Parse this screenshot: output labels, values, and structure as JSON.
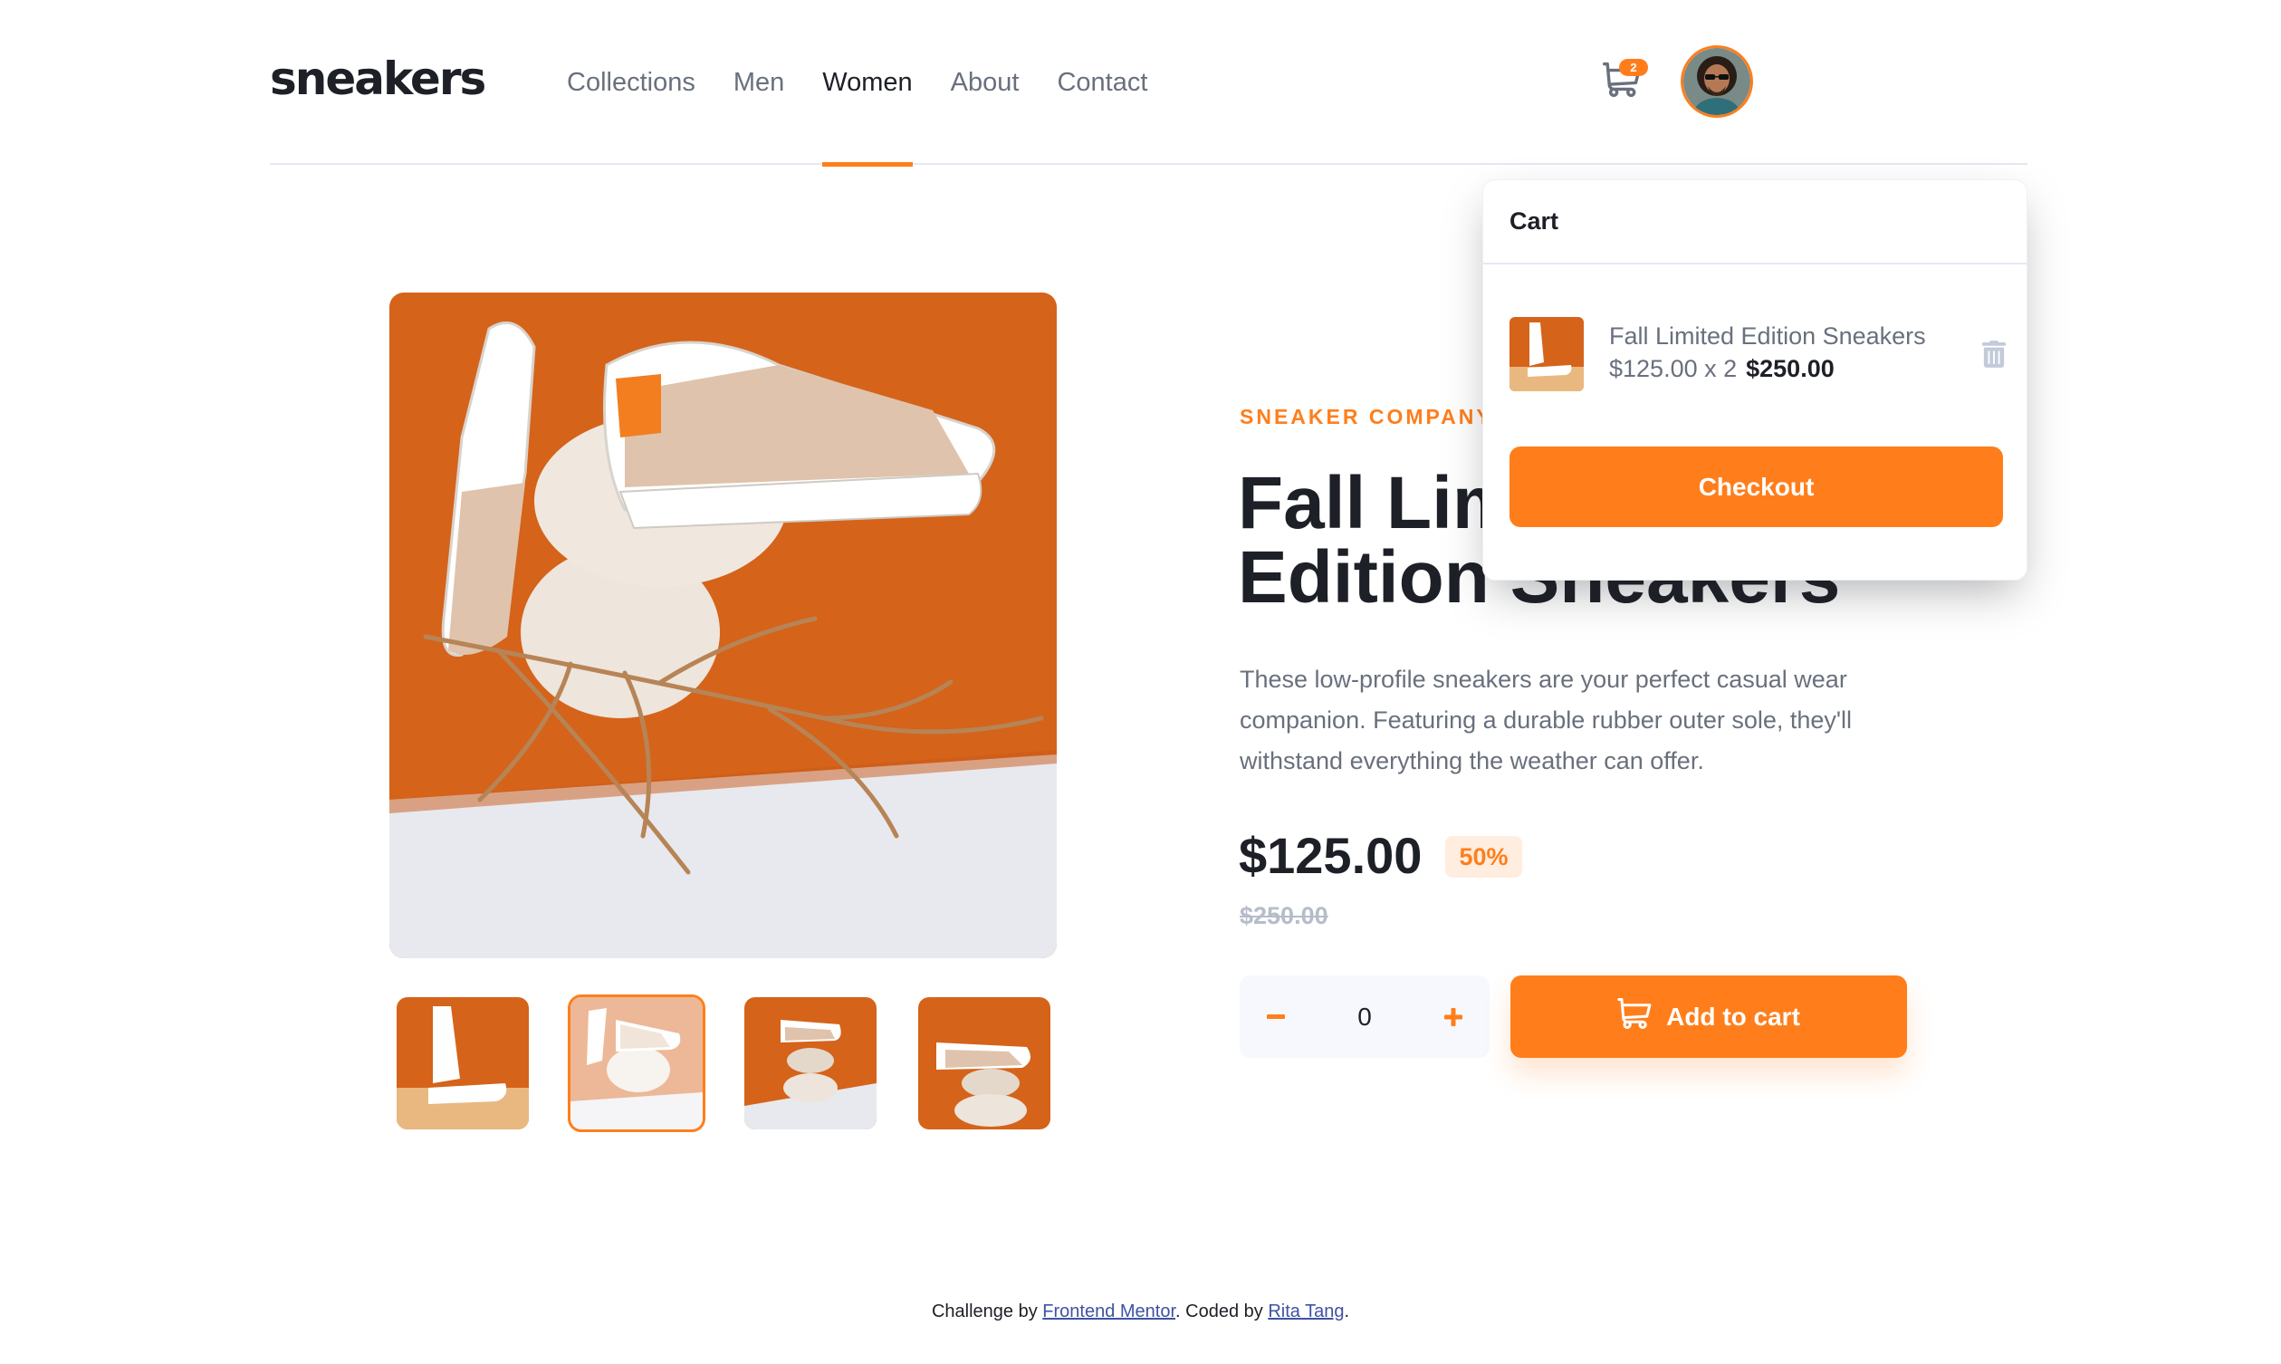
{
  "brand": {
    "logo": "sneakers"
  },
  "nav": {
    "items": [
      {
        "label": "Collections",
        "active": false
      },
      {
        "label": "Men",
        "active": false
      },
      {
        "label": "Women",
        "active": true
      },
      {
        "label": "About",
        "active": false
      },
      {
        "label": "Contact",
        "active": false
      }
    ]
  },
  "header": {
    "cart_count": "2",
    "cart_icon": "cart-icon",
    "avatar_icon": "user-avatar"
  },
  "gallery": {
    "main_image": "sneaker-on-stones-photo",
    "thumbnails": [
      {
        "name": "thumbnail-1",
        "active": false
      },
      {
        "name": "thumbnail-2",
        "active": true
      },
      {
        "name": "thumbnail-3",
        "active": false
      },
      {
        "name": "thumbnail-4",
        "active": false
      }
    ]
  },
  "product": {
    "company": "SNEAKER COMPANY",
    "title": "Fall Limited Edition Sneakers",
    "description": "These low-profile sneakers are your perfect casual wear companion. Featuring a durable rubber outer sole, they'll withstand everything the weather can offer.",
    "price": "$125.00",
    "discount": "50%",
    "original_price": "$250.00",
    "quantity": "0",
    "add_to_cart_label": "Add to cart"
  },
  "cart": {
    "title": "Cart",
    "item": {
      "name": "Fall Limited Edition Sneakers",
      "unit_line": "$125.00 x 2",
      "total": "$250.00"
    },
    "checkout_label": "Checkout"
  },
  "footer": {
    "prefix": "Challenge by ",
    "link1": "Frontend Mentor",
    "middle": ". Coded by ",
    "link2": "Rita Tang",
    "suffix": "."
  },
  "colors": {
    "accent": "#ff7e1b",
    "accent_pale": "#ffede0",
    "text_dark": "#1d2026",
    "text_muted": "#69707d"
  }
}
